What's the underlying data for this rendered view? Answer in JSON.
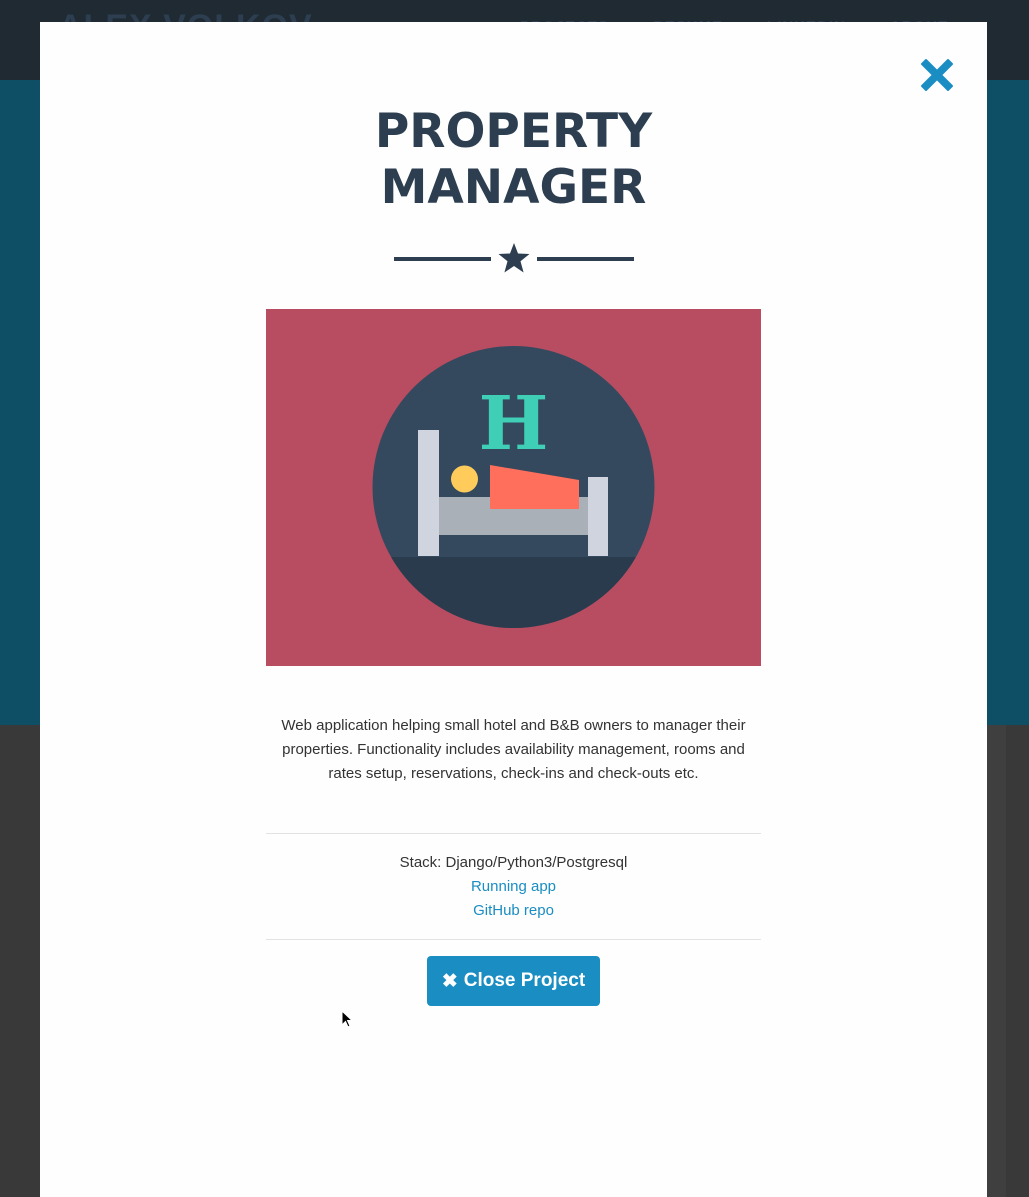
{
  "background": {
    "brand": "ALEX VOLKOV",
    "nav_links": [
      "PROJECTS",
      "RESUME",
      "LINKEDIN",
      "ABOUT"
    ]
  },
  "modal": {
    "title_line1": "PROPERTY",
    "title_line2": "MANAGER",
    "divider_icon": "star-icon",
    "image_icon": "hotel-bed-icon",
    "image_letter": "H",
    "description": "Web application helping small hotel and B&B owners to manager their properties. Functionality includes availability management, rooms and rates setup, reservations, check-ins and check-outs etc.",
    "stack": "Stack: Django/Python3/Postgresql",
    "running_app_link": "Running app",
    "github_link": "GitHub repo",
    "close_button_label": "Close Project",
    "close_button_icon": "close-icon"
  },
  "colors": {
    "accent": "#1a8dc3",
    "title": "#2c3e50",
    "image_background": "#b84d62"
  }
}
